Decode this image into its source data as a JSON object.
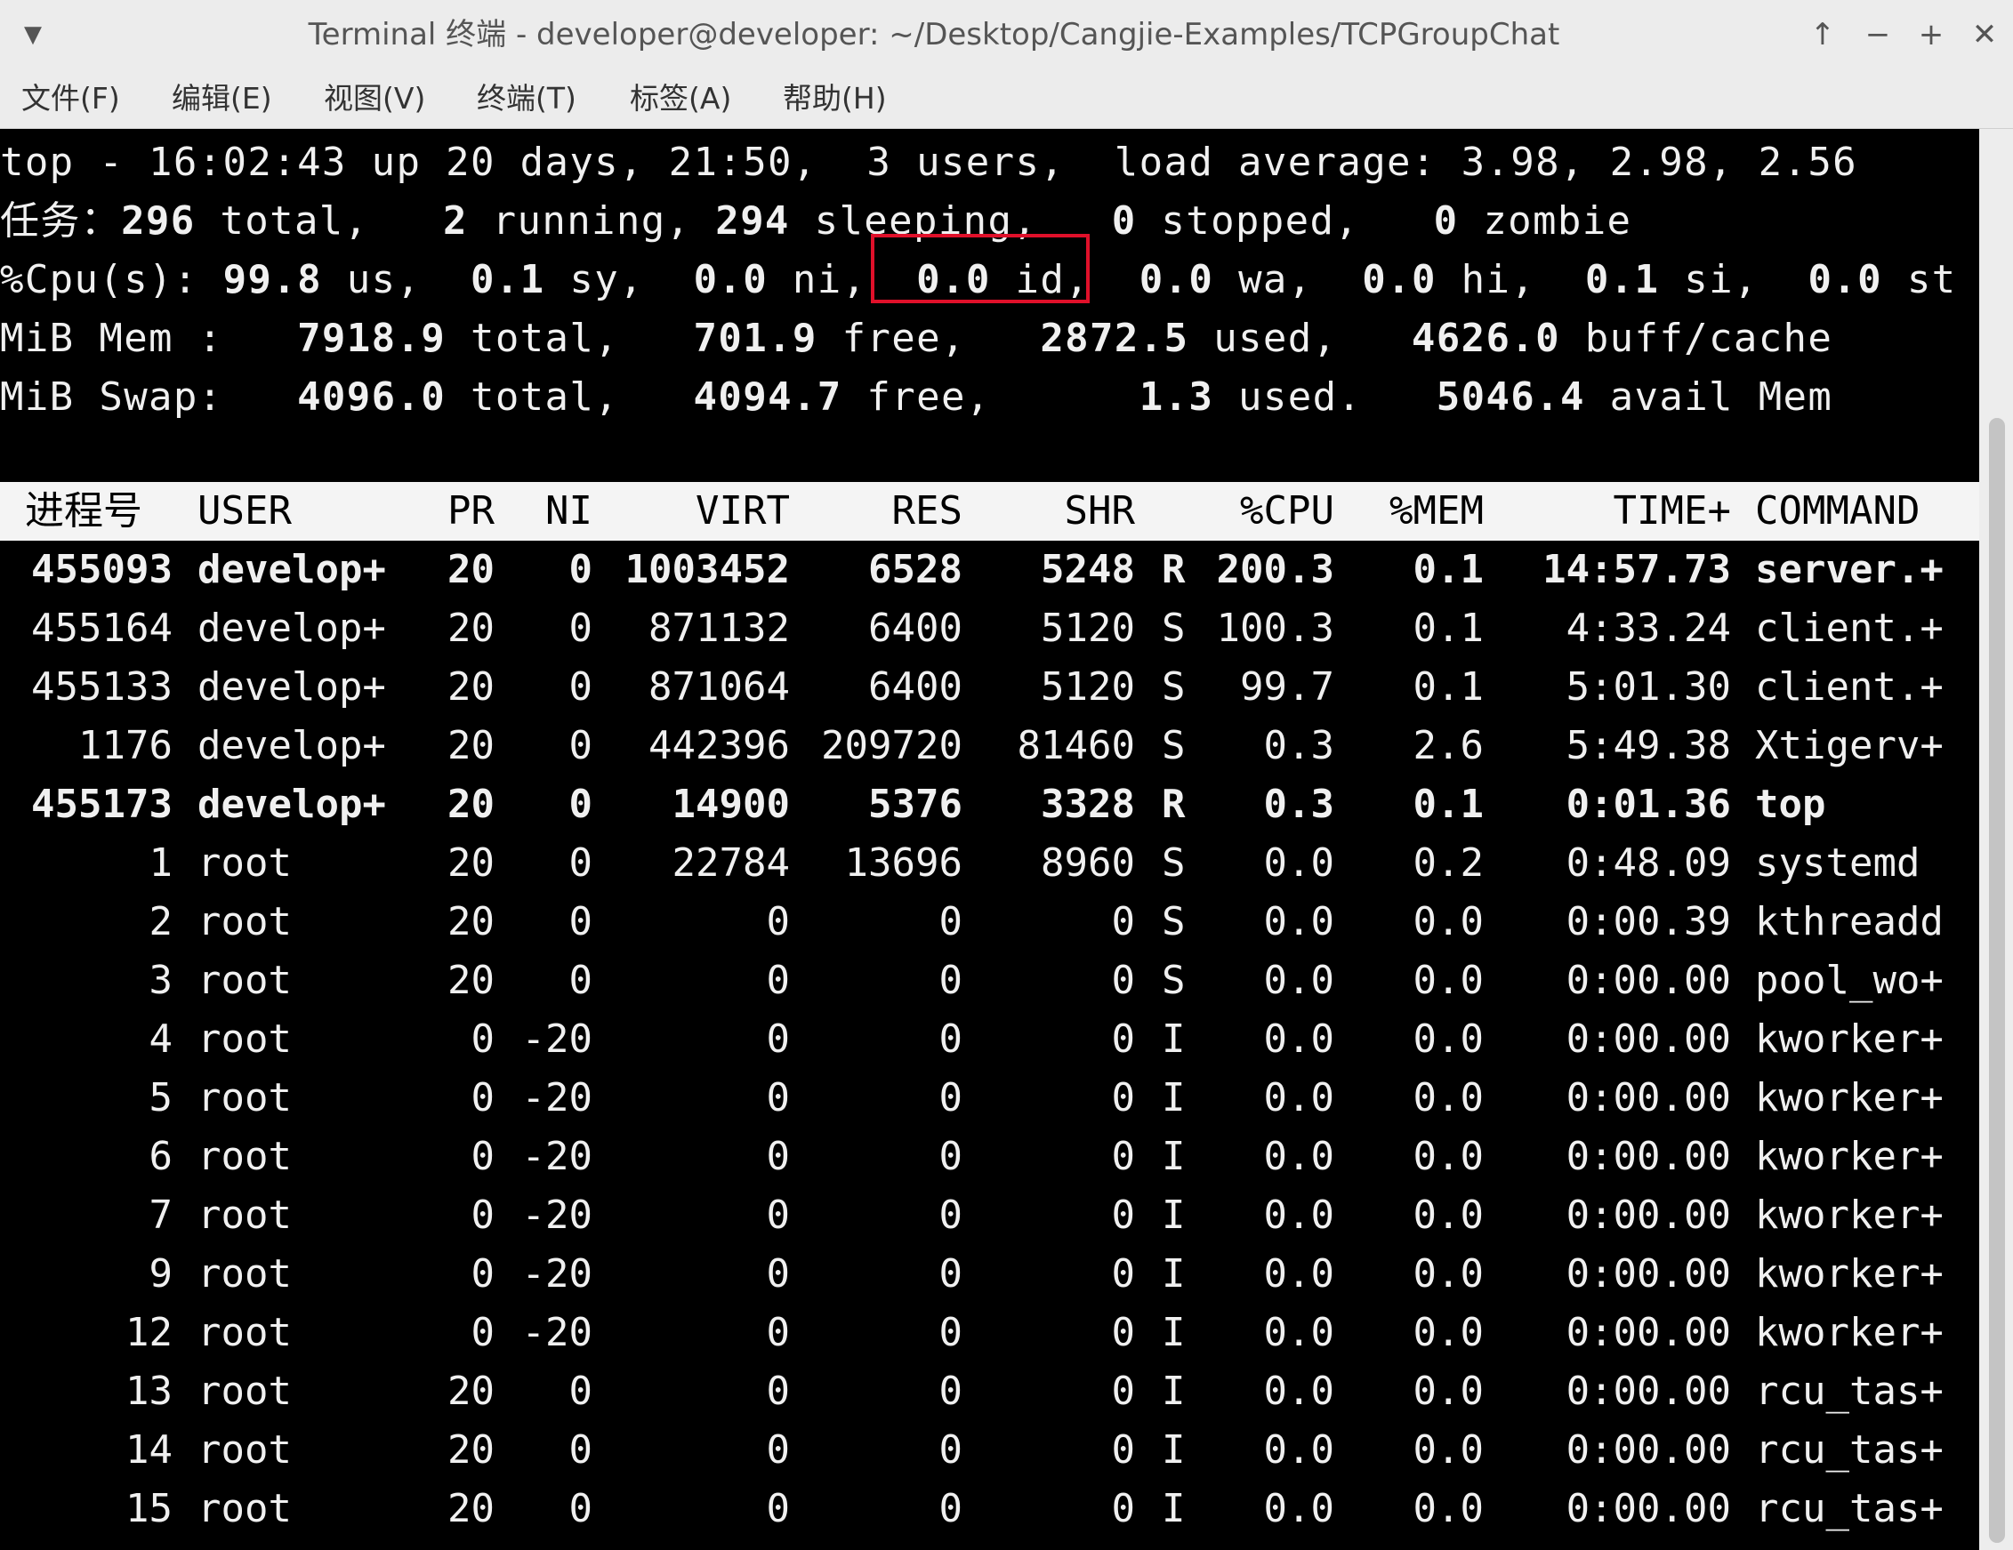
{
  "window": {
    "title": "Terminal 终端 - developer@developer: ~/Desktop/Cangjie-Examples/TCPGroupChat",
    "menu_icon": "▼",
    "scroll_up_icon": "↑",
    "minimize_icon": "−",
    "maximize_icon": "+",
    "close_icon": "✕"
  },
  "menu": [
    {
      "label": "文件(F)"
    },
    {
      "label": "编辑(E)"
    },
    {
      "label": "视图(V)"
    },
    {
      "label": "终端(T)"
    },
    {
      "label": "标签(A)"
    },
    {
      "label": "帮助(H)"
    }
  ],
  "summary": {
    "l1": {
      "a": "top - 16:02:43 up 20 days, 21:50,  3 users,  load average: 3.98, 2.98, 2.56"
    },
    "l2": {
      "a": "任务：",
      "b": "296",
      "c": " total,   ",
      "d": "2",
      "e": " running, ",
      "f": "294",
      "g": " sleeping,   ",
      "h": "0",
      "i": " stopped,   ",
      "j": "0",
      "k": " zombie"
    },
    "l3": {
      "a": "%Cpu(s): ",
      "b": "99.8",
      "c": " us,  ",
      "d": "0.1",
      "e": " sy,  ",
      "f": "0.0",
      "g": " ni,  ",
      "h": "0.0",
      "i": " id,  ",
      "j": "0.0",
      "k": " wa,  ",
      "l": "0.0",
      "m": " hi,  ",
      "n": "0.1",
      "o": " si,  ",
      "p": "0.0",
      "q": " st"
    },
    "l4": {
      "a": "MiB Mem :   ",
      "b": "7918.9",
      "c": " total,   ",
      "d": "701.9",
      "e": " free,   ",
      "f": "2872.5",
      "g": " used,   ",
      "h": "4626.0",
      "i": " buff/cache"
    },
    "l5": {
      "a": "MiB Swap:   ",
      "b": "4096.0",
      "c": " total,   ",
      "d": "4094.7",
      "e": " free,      ",
      "f": "1.3",
      "g": " used.   ",
      "h": "5046.4",
      "i": " avail Mem"
    }
  },
  "columns": {
    "pid": "进程号",
    "user": "USER",
    "pr": "PR",
    "ni": "NI",
    "virt": "VIRT",
    "res": "RES",
    "shr": "SHR",
    "s": "",
    "cpu": "%CPU",
    "mem": "%MEM",
    "time": "TIME+",
    "cmd": "COMMAND"
  },
  "processes": [
    {
      "pid": "455093",
      "user": "develop+",
      "pr": "20",
      "ni": "0",
      "virt": "1003452",
      "res": "6528",
      "shr": "5248",
      "s": "R",
      "cpu": "200.3",
      "mem": "0.1",
      "time": "14:57.73",
      "cmd": "server.+",
      "bold": true
    },
    {
      "pid": "455164",
      "user": "develop+",
      "pr": "20",
      "ni": "0",
      "virt": "871132",
      "res": "6400",
      "shr": "5120",
      "s": "S",
      "cpu": "100.3",
      "mem": "0.1",
      "time": "4:33.24",
      "cmd": "client.+",
      "bold": false
    },
    {
      "pid": "455133",
      "user": "develop+",
      "pr": "20",
      "ni": "0",
      "virt": "871064",
      "res": "6400",
      "shr": "5120",
      "s": "S",
      "cpu": "99.7",
      "mem": "0.1",
      "time": "5:01.30",
      "cmd": "client.+",
      "bold": false
    },
    {
      "pid": "1176",
      "user": "develop+",
      "pr": "20",
      "ni": "0",
      "virt": "442396",
      "res": "209720",
      "shr": "81460",
      "s": "S",
      "cpu": "0.3",
      "mem": "2.6",
      "time": "5:49.38",
      "cmd": "Xtigerv+",
      "bold": false
    },
    {
      "pid": "455173",
      "user": "develop+",
      "pr": "20",
      "ni": "0",
      "virt": "14900",
      "res": "5376",
      "shr": "3328",
      "s": "R",
      "cpu": "0.3",
      "mem": "0.1",
      "time": "0:01.36",
      "cmd": "top",
      "bold": true
    },
    {
      "pid": "1",
      "user": "root",
      "pr": "20",
      "ni": "0",
      "virt": "22784",
      "res": "13696",
      "shr": "8960",
      "s": "S",
      "cpu": "0.0",
      "mem": "0.2",
      "time": "0:48.09",
      "cmd": "systemd",
      "bold": false
    },
    {
      "pid": "2",
      "user": "root",
      "pr": "20",
      "ni": "0",
      "virt": "0",
      "res": "0",
      "shr": "0",
      "s": "S",
      "cpu": "0.0",
      "mem": "0.0",
      "time": "0:00.39",
      "cmd": "kthreadd",
      "bold": false
    },
    {
      "pid": "3",
      "user": "root",
      "pr": "20",
      "ni": "0",
      "virt": "0",
      "res": "0",
      "shr": "0",
      "s": "S",
      "cpu": "0.0",
      "mem": "0.0",
      "time": "0:00.00",
      "cmd": "pool_wo+",
      "bold": false
    },
    {
      "pid": "4",
      "user": "root",
      "pr": "0",
      "ni": "-20",
      "virt": "0",
      "res": "0",
      "shr": "0",
      "s": "I",
      "cpu": "0.0",
      "mem": "0.0",
      "time": "0:00.00",
      "cmd": "kworker+",
      "bold": false
    },
    {
      "pid": "5",
      "user": "root",
      "pr": "0",
      "ni": "-20",
      "virt": "0",
      "res": "0",
      "shr": "0",
      "s": "I",
      "cpu": "0.0",
      "mem": "0.0",
      "time": "0:00.00",
      "cmd": "kworker+",
      "bold": false
    },
    {
      "pid": "6",
      "user": "root",
      "pr": "0",
      "ni": "-20",
      "virt": "0",
      "res": "0",
      "shr": "0",
      "s": "I",
      "cpu": "0.0",
      "mem": "0.0",
      "time": "0:00.00",
      "cmd": "kworker+",
      "bold": false
    },
    {
      "pid": "7",
      "user": "root",
      "pr": "0",
      "ni": "-20",
      "virt": "0",
      "res": "0",
      "shr": "0",
      "s": "I",
      "cpu": "0.0",
      "mem": "0.0",
      "time": "0:00.00",
      "cmd": "kworker+",
      "bold": false
    },
    {
      "pid": "9",
      "user": "root",
      "pr": "0",
      "ni": "-20",
      "virt": "0",
      "res": "0",
      "shr": "0",
      "s": "I",
      "cpu": "0.0",
      "mem": "0.0",
      "time": "0:00.00",
      "cmd": "kworker+",
      "bold": false
    },
    {
      "pid": "12",
      "user": "root",
      "pr": "0",
      "ni": "-20",
      "virt": "0",
      "res": "0",
      "shr": "0",
      "s": "I",
      "cpu": "0.0",
      "mem": "0.0",
      "time": "0:00.00",
      "cmd": "kworker+",
      "bold": false
    },
    {
      "pid": "13",
      "user": "root",
      "pr": "20",
      "ni": "0",
      "virt": "0",
      "res": "0",
      "shr": "0",
      "s": "I",
      "cpu": "0.0",
      "mem": "0.0",
      "time": "0:00.00",
      "cmd": "rcu_tas+",
      "bold": false
    },
    {
      "pid": "14",
      "user": "root",
      "pr": "20",
      "ni": "0",
      "virt": "0",
      "res": "0",
      "shr": "0",
      "s": "I",
      "cpu": "0.0",
      "mem": "0.0",
      "time": "0:00.00",
      "cmd": "rcu_tas+",
      "bold": false
    },
    {
      "pid": "15",
      "user": "root",
      "pr": "20",
      "ni": "0",
      "virt": "0",
      "res": "0",
      "shr": "0",
      "s": "I",
      "cpu": "0.0",
      "mem": "0.0",
      "time": "0:00.00",
      "cmd": "rcu_tas+",
      "bold": false
    }
  ],
  "colors": {
    "terminal_bg": "#000000",
    "terminal_fg": "#f0f0f0",
    "header_bg": "#f4f4f4",
    "highlight": "#e0102a",
    "chrome": "#ececec"
  }
}
